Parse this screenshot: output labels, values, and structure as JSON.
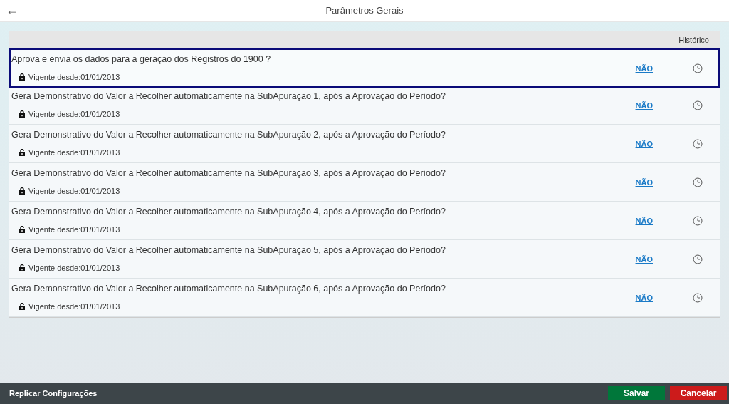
{
  "header": {
    "back": "←",
    "title": "Parâmetros Gerais"
  },
  "table": {
    "columns": [
      "Histórico"
    ],
    "rows": [
      {
        "question": "Aprova e envia os dados para a geração dos Registros do 1900 ?",
        "validity": "Vigente desde:01/01/2013",
        "value": "NÃO",
        "selected": true
      },
      {
        "question": "Gera Demonstrativo do Valor a Recolher automaticamente na SubApuração 1, após a Aprovação do Período?",
        "validity": "Vigente desde:01/01/2013",
        "value": "NÃO",
        "selected": false
      },
      {
        "question": "Gera Demonstrativo do Valor a Recolher automaticamente na SubApuração 2, após a Aprovação do Período?",
        "validity": "Vigente desde:01/01/2013",
        "value": "NÃO",
        "selected": false
      },
      {
        "question": "Gera Demonstrativo do Valor a Recolher automaticamente na SubApuração 3, após a Aprovação do Período?",
        "validity": "Vigente desde:01/01/2013",
        "value": "NÃO",
        "selected": false
      },
      {
        "question": "Gera Demonstrativo do Valor a Recolher automaticamente na SubApuração 4, após a Aprovação do Período?",
        "validity": "Vigente desde:01/01/2013",
        "value": "NÃO",
        "selected": false
      },
      {
        "question": "Gera Demonstrativo do Valor a Recolher automaticamente na SubApuração 5, após a Aprovação do Período?",
        "validity": "Vigente desde:01/01/2013",
        "value": "NÃO",
        "selected": false
      },
      {
        "question": "Gera Demonstrativo do Valor a Recolher automaticamente na SubApuração 6, após a Aprovação do Período?",
        "validity": "Vigente desde:01/01/2013",
        "value": "NÃO",
        "selected": false
      }
    ]
  },
  "footer": {
    "replicate": "Replicar Configurações",
    "save": "Salvar",
    "cancel": "Cancelar"
  }
}
